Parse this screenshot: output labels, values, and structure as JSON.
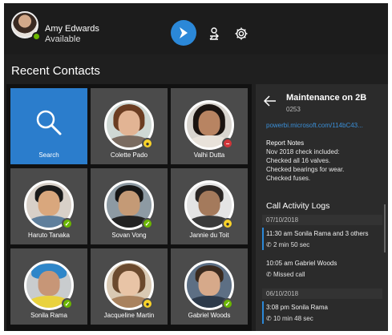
{
  "user": {
    "name": "Amy Edwards",
    "status": "Available"
  },
  "header": {
    "brand_icon": "dynamics-icon",
    "icons": [
      "transfer-icon",
      "gear-icon"
    ]
  },
  "section_title": "Recent Contacts",
  "colors": {
    "available": "#6bb700",
    "away": "#f8d22a",
    "busy": "#d13438",
    "accent": "#2b7dcc"
  },
  "contacts": [
    {
      "name": "Search",
      "type": "search"
    },
    {
      "name": "Colette Pado",
      "presence": "away"
    },
    {
      "name": "Valhi Dutta",
      "presence": "busy"
    },
    {
      "name": "Haruto Tanaka",
      "presence": "available"
    },
    {
      "name": "Sovan Vong",
      "presence": "available"
    },
    {
      "name": "Jannie du Toit",
      "presence": "away"
    },
    {
      "name": "Sonila Rama",
      "presence": "available"
    },
    {
      "name": "Jacqueline Martin",
      "presence": "away"
    },
    {
      "name": "Gabriel Woods",
      "presence": "available"
    }
  ],
  "panel": {
    "title": "Maintenance on 2B",
    "subtitle": "0253",
    "link": "powerbi.microsoft.com/114bC43...",
    "notes_label": "Report Notes",
    "notes": [
      "Nov 2018 check included:",
      "Checked all 16 valves.",
      "Checked bearings for wear.",
      "Checked fuses."
    ],
    "logs_title": "Call Activity Logs",
    "groups": [
      {
        "date": "07/10/2018",
        "entries": [
          {
            "text": "11:30 am Sonila Rama and 3 others",
            "meta": "2 min 50 sec",
            "icon": "call-icon"
          },
          {
            "text": "10:05 am Gabriel Woods",
            "meta": "Missed call",
            "icon": "missed-call-icon"
          }
        ]
      },
      {
        "date": "06/10/2018",
        "entries": [
          {
            "text": "3:08 pm Sonila Rama",
            "meta": "10 min 48 sec",
            "icon": "call-icon"
          }
        ]
      }
    ]
  }
}
